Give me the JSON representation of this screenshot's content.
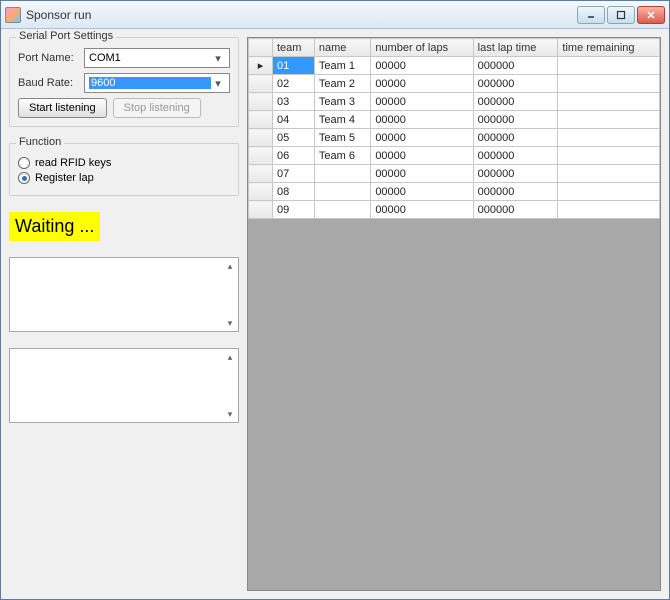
{
  "window": {
    "title": "Sponsor run"
  },
  "serial": {
    "legend": "Serial Port Settings",
    "portNameLabel": "Port Name:",
    "portNameValue": "COM1",
    "baudRateLabel": "Baud Rate:",
    "baudRateValue": "9600",
    "startBtn": "Start listening",
    "stopBtn": "Stop listening"
  },
  "function": {
    "legend": "Function",
    "opt1": "read RFID keys",
    "opt2": "Register lap",
    "selected": "opt2"
  },
  "status": "Waiting ...",
  "grid": {
    "columns": [
      "team",
      "name",
      "number of laps",
      "last lap time",
      "time remaining"
    ],
    "rows": [
      {
        "team": "01",
        "name": "Team 1",
        "laps": "00000",
        "lastLap": "000000",
        "remaining": ""
      },
      {
        "team": "02",
        "name": "Team 2",
        "laps": "00000",
        "lastLap": "000000",
        "remaining": ""
      },
      {
        "team": "03",
        "name": "Team 3",
        "laps": "00000",
        "lastLap": "000000",
        "remaining": ""
      },
      {
        "team": "04",
        "name": "Team 4",
        "laps": "00000",
        "lastLap": "000000",
        "remaining": ""
      },
      {
        "team": "05",
        "name": "Team 5",
        "laps": "00000",
        "lastLap": "000000",
        "remaining": ""
      },
      {
        "team": "06",
        "name": "Team 6",
        "laps": "00000",
        "lastLap": "000000",
        "remaining": ""
      },
      {
        "team": "07",
        "name": "",
        "laps": "00000",
        "lastLap": "000000",
        "remaining": ""
      },
      {
        "team": "08",
        "name": "",
        "laps": "00000",
        "lastLap": "000000",
        "remaining": ""
      },
      {
        "team": "09",
        "name": "",
        "laps": "00000",
        "lastLap": "000000",
        "remaining": ""
      }
    ],
    "selectedRow": 0
  }
}
